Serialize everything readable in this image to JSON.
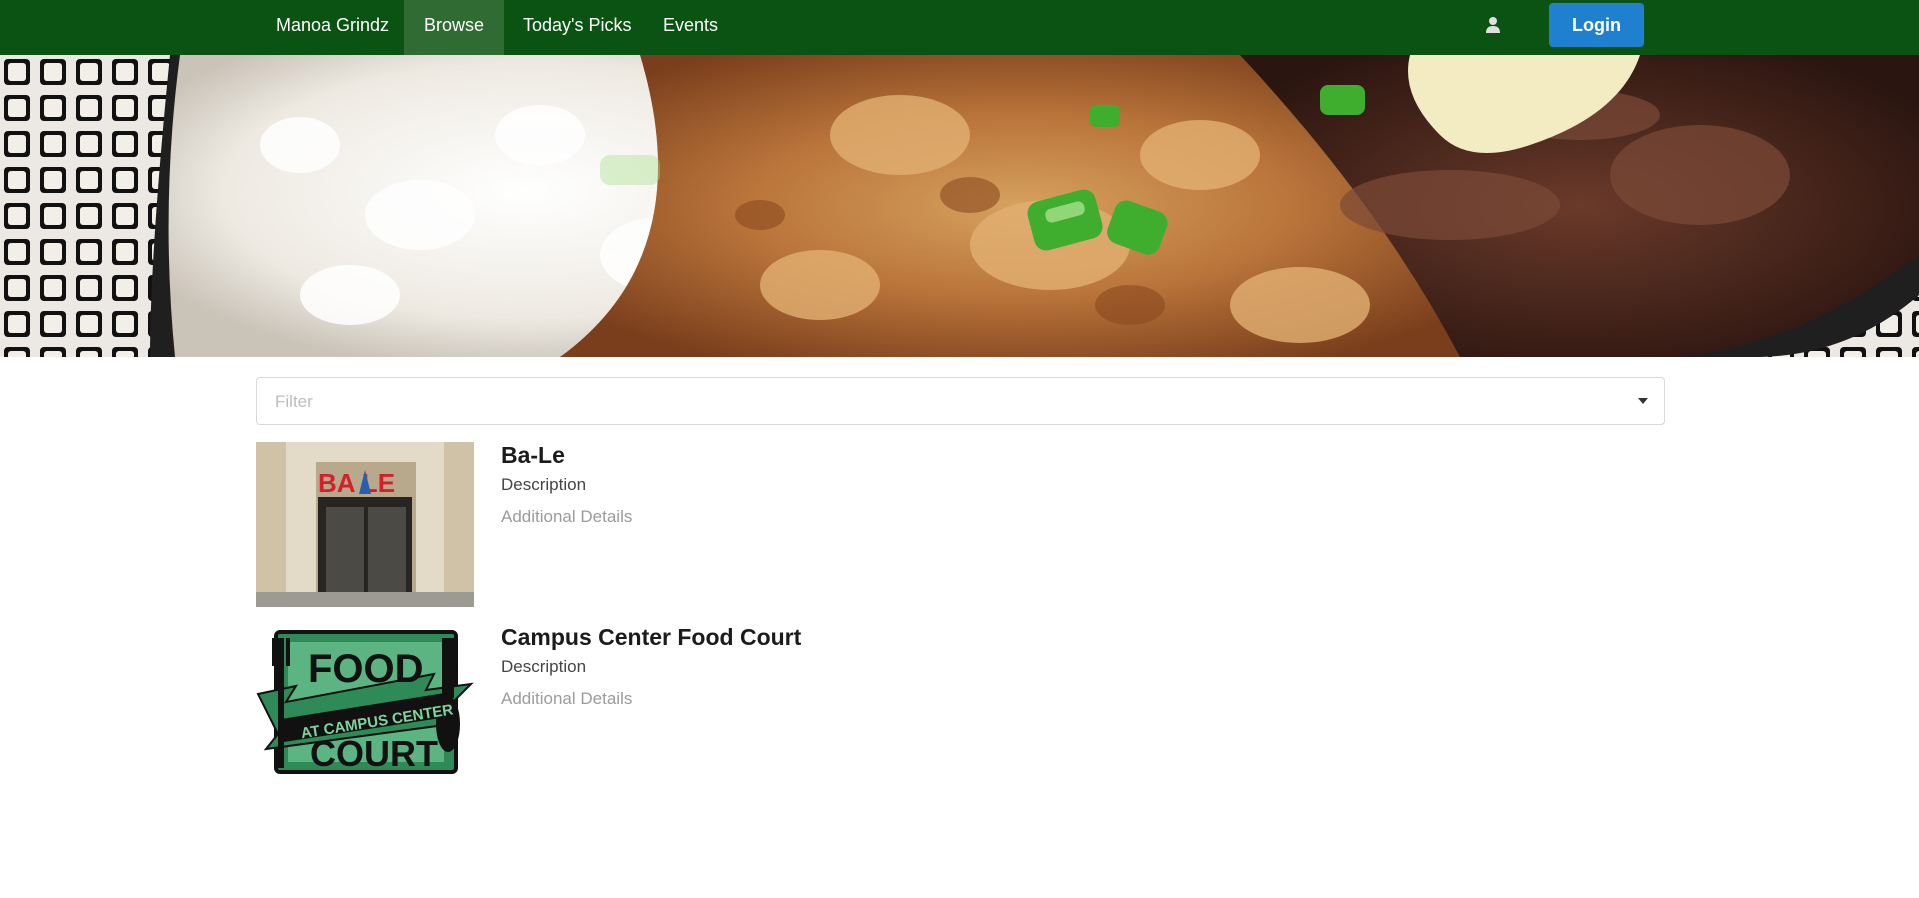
{
  "nav": {
    "brand": "Manoa Grindz",
    "items": [
      {
        "label": "Browse",
        "active": true
      },
      {
        "label": "Today's Picks",
        "active": false
      },
      {
        "label": "Events",
        "active": false
      }
    ],
    "login_label": "Login",
    "user_icon": "user-icon",
    "bg_color": "#0b5312",
    "login_color": "#1f80d0"
  },
  "banner": {
    "image": "food-plate-photo"
  },
  "filter": {
    "placeholder": "Filter"
  },
  "vendors": [
    {
      "name": "Ba-Le",
      "description": "Description",
      "details": "Additional Details",
      "logo_text": "BA LE"
    },
    {
      "name": "Campus Center Food Court",
      "description": "Description",
      "details": "Additional Details",
      "logo_text_top": "FOOD",
      "logo_text_mid": "AT CAMPUS CENTER",
      "logo_text_bottom": "COURT"
    }
  ]
}
